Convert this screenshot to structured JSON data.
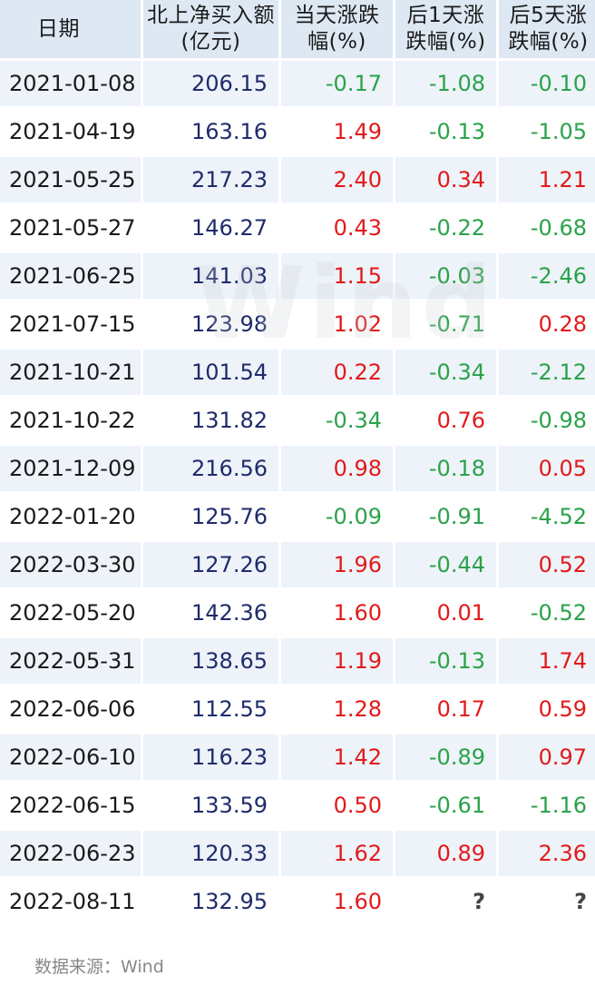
{
  "table": {
    "headers": [
      "日期",
      "北上净买入额(亿元)",
      "当天涨跌幅(%)",
      "后1天涨跌幅(%)",
      "后5天涨跌幅(%)"
    ],
    "rows": [
      [
        "2021-01-08",
        "206.15",
        "-0.17",
        "-1.08",
        "-0.10"
      ],
      [
        "2021-04-19",
        "163.16",
        "1.49",
        "-0.13",
        "-1.05"
      ],
      [
        "2021-05-25",
        "217.23",
        "2.40",
        "0.34",
        "1.21"
      ],
      [
        "2021-05-27",
        "146.27",
        "0.43",
        "-0.22",
        "-0.68"
      ],
      [
        "2021-06-25",
        "141.03",
        "1.15",
        "-0.03",
        "-2.46"
      ],
      [
        "2021-07-15",
        "123.98",
        "1.02",
        "-0.71",
        "0.28"
      ],
      [
        "2021-10-21",
        "101.54",
        "0.22",
        "-0.34",
        "-2.12"
      ],
      [
        "2021-10-22",
        "131.82",
        "-0.34",
        "0.76",
        "-0.98"
      ],
      [
        "2021-12-09",
        "216.56",
        "0.98",
        "-0.18",
        "0.05"
      ],
      [
        "2022-01-20",
        "125.76",
        "-0.09",
        "-0.91",
        "-4.52"
      ],
      [
        "2022-03-30",
        "127.26",
        "1.96",
        "-0.44",
        "0.52"
      ],
      [
        "2022-05-20",
        "142.36",
        "1.60",
        "0.01",
        "-0.52"
      ],
      [
        "2022-05-31",
        "138.65",
        "1.19",
        "-0.13",
        "1.74"
      ],
      [
        "2022-06-06",
        "112.55",
        "1.28",
        "0.17",
        "0.59"
      ],
      [
        "2022-06-10",
        "116.23",
        "1.42",
        "-0.89",
        "0.97"
      ],
      [
        "2022-06-15",
        "133.59",
        "0.50",
        "-0.61",
        "-1.16"
      ],
      [
        "2022-06-23",
        "120.33",
        "1.62",
        "0.89",
        "2.36"
      ],
      [
        "2022-08-11",
        "132.95",
        "1.60",
        "?",
        "?"
      ]
    ]
  },
  "watermark": "Wind",
  "source": "数据来源：Wind",
  "colors": {
    "positive": "#e21a1a",
    "negative": "#2aa24a",
    "amount": "#1f2b6b",
    "header_bg": "#dde8f3",
    "row_alt_bg": "#edf3f9"
  }
}
